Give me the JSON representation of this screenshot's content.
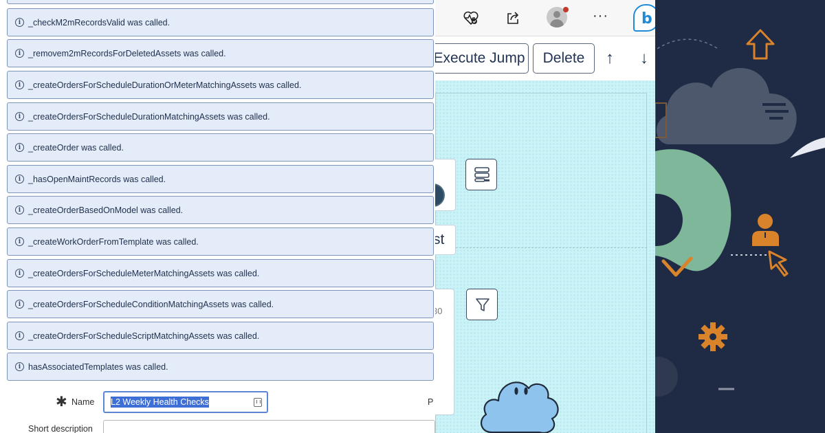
{
  "messages": [
    "_checkM2mRecordsValid was called.",
    "_removem2mRecordsForDeletedAssets was called.",
    "_createOrdersForScheduleDurationOrMeterMatchingAssets was called.",
    "_createOrdersForScheduleDurationMatchingAssets was called.",
    "_createOrder was called.",
    "_hasOpenMaintRecords was called.",
    "_createOrderBasedOnModel was called.",
    "_createWorkOrderFromTemplate was called.",
    "_createOrdersForScheduleMeterMatchingAssets was called.",
    "_createOrdersForScheduleConditionMatchingAssets was called.",
    "_createOrdersForScheduleScriptMatchingAssets was called.",
    "hasAssociatedTemplates was called."
  ],
  "form": {
    "required_marker": "✱",
    "name_label": "Name",
    "name_value": "L2 Weekly Health Checks",
    "short_description_label": "Short description",
    "truncated_label": "P"
  },
  "browser": {
    "more_label": "···",
    "bing_label": "b"
  },
  "actions": {
    "execute_jump_label": "Execute Jump",
    "delete_label": "Delete",
    "up_arrow": "↑",
    "down_arrow": "↓"
  },
  "canvas": {
    "card_2_text": "st",
    "card_3_text": "30"
  },
  "colors": {
    "info_bg": "#e3ecf8",
    "info_border": "#7d95b8",
    "canvas_bg": "#c9f3f7",
    "illustration_bg": "#1f2a44",
    "accent_orange": "#d9832b",
    "accent_green": "#7fb79a"
  }
}
